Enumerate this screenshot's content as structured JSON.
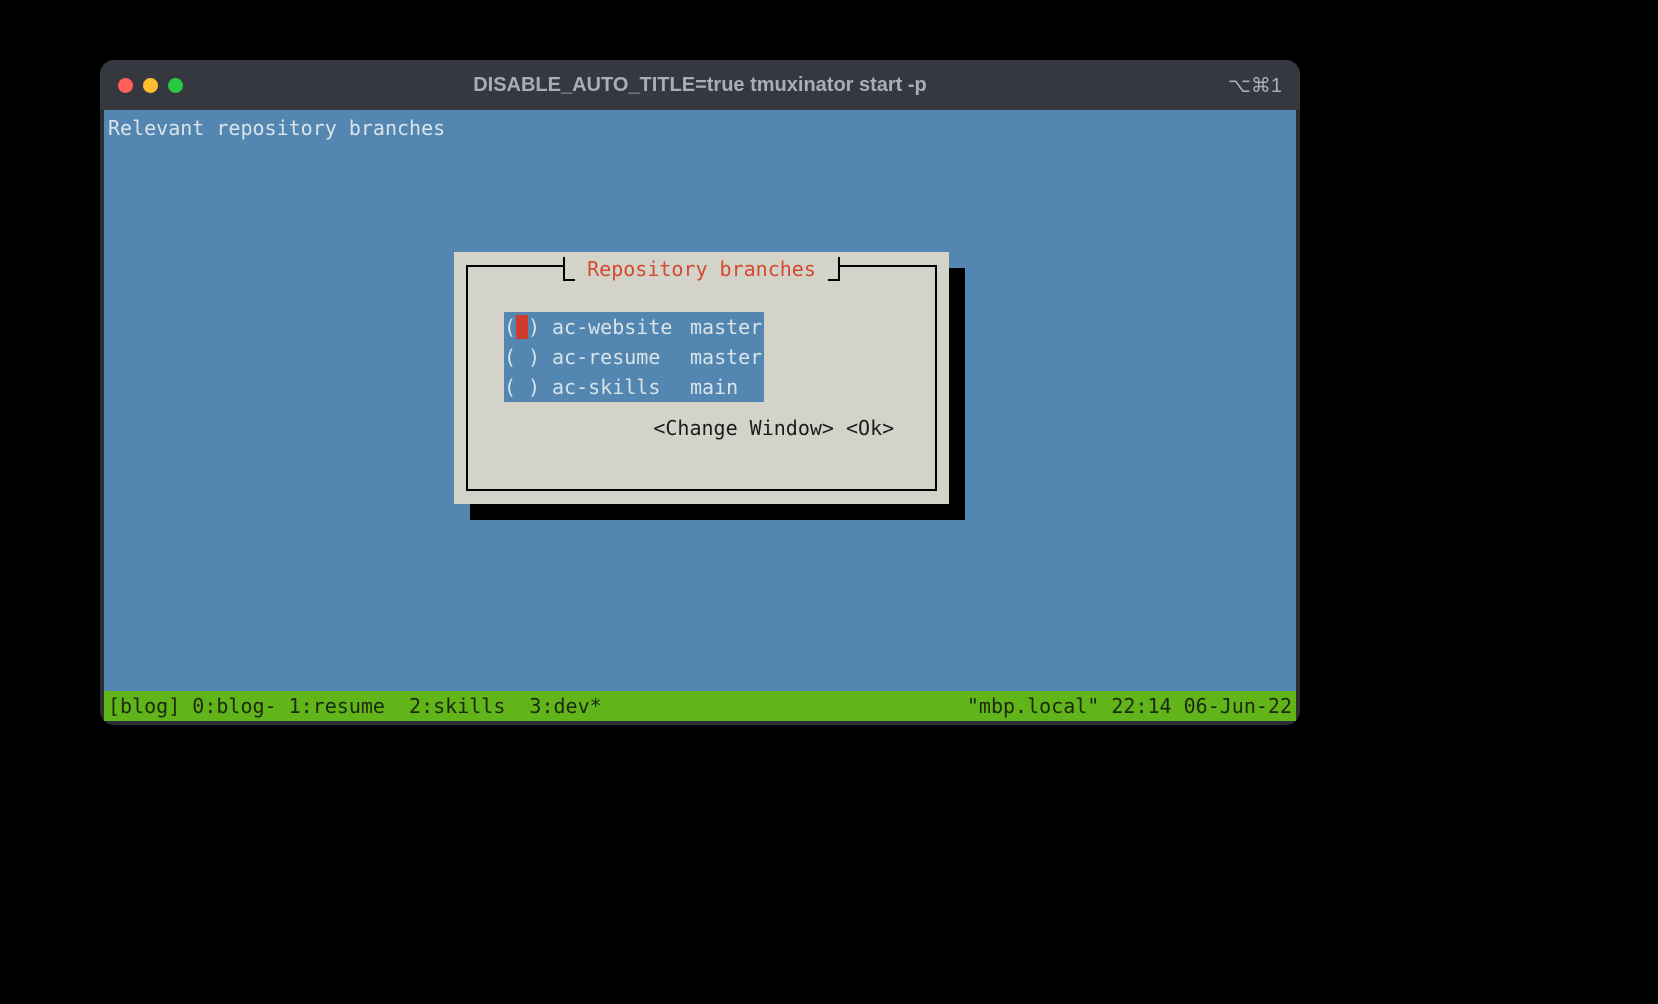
{
  "window": {
    "title": "DISABLE_AUTO_TITLE=true tmuxinator start -p",
    "shortcut": "⌥⌘1"
  },
  "header": "Relevant repository branches",
  "dialog": {
    "title": "Repository branches",
    "items": [
      {
        "name": "ac-website",
        "branch": "master",
        "selected": true
      },
      {
        "name": "ac-resume",
        "branch": "master",
        "selected": false
      },
      {
        "name": "ac-skills",
        "branch": "main",
        "selected": false
      }
    ],
    "buttons": {
      "change": "<Change Window>",
      "ok": "<Ok>"
    }
  },
  "status": {
    "left": "[blog] 0:blog- 1:resume  2:skills  3:dev*",
    "right": "\"mbp.local\" 22:14 06-Jun-22"
  }
}
